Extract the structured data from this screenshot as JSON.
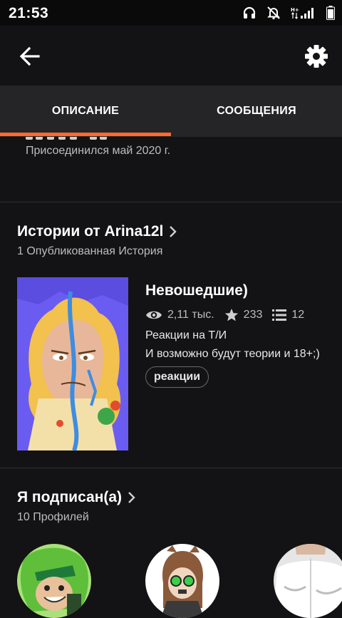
{
  "status_bar": {
    "time": "21:53"
  },
  "tabs": [
    {
      "label": "ОПИСАНИЕ",
      "active": true
    },
    {
      "label": "СООБЩЕНИЯ",
      "active": false
    }
  ],
  "profile": {
    "joined": "Присоединился май 2020 г."
  },
  "stories": {
    "title": "Истории от Arina12l",
    "subtitle": "1 Опубликованная История",
    "items": [
      {
        "title": "Невошедшие)",
        "views": "2,11 тыс.",
        "votes": "233",
        "parts": "12",
        "description": [
          "Реакции на Т/И",
          "И возможно будут теории и 18+;)"
        ],
        "tag": "реакции"
      }
    ]
  },
  "following": {
    "title": "Я подписан(а)",
    "subtitle": "10 Профилей"
  },
  "colors": {
    "accent": "#ff6b2c",
    "background": "#131214",
    "tab_bar": "#252427"
  }
}
